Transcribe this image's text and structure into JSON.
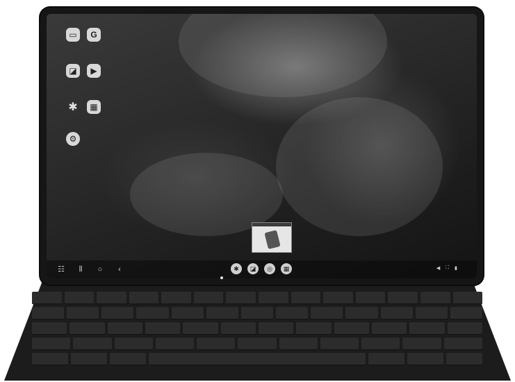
{
  "desktop": {
    "apps": [
      {
        "icon": "message-app-icon",
        "glyph": "▭",
        "label": ""
      },
      {
        "icon": "google-app-icon",
        "glyph": "G",
        "label": ""
      },
      {
        "icon": "gallery-app-icon",
        "glyph": "◪",
        "label": ""
      },
      {
        "icon": "play-store-icon",
        "glyph": "▶",
        "label": ""
      },
      {
        "icon": "bixby-app-icon",
        "glyph": "✱",
        "label": ""
      },
      {
        "icon": "apps-grid-icon",
        "glyph": "▦",
        "label": ""
      },
      {
        "icon": "settings-app-icon",
        "glyph": "⚙",
        "label": ""
      }
    ]
  },
  "recent_preview": {
    "caption": ""
  },
  "taskbar": {
    "nav": {
      "apps_glyph": "☷",
      "recents_glyph": "⦀",
      "home_glyph": "○",
      "back_glyph": "‹"
    },
    "dock": [
      {
        "icon": "bixby-dock-icon",
        "glyph": "✱"
      },
      {
        "icon": "gallery-dock-icon",
        "glyph": "◪"
      },
      {
        "icon": "samsung-internet-icon",
        "glyph": "◎"
      },
      {
        "icon": "apps-dock-icon",
        "glyph": "▦"
      }
    ],
    "status": {
      "volume_glyph": "◀",
      "screenshot_glyph": "⛶",
      "battery_glyph": "▮",
      "network_text": "",
      "time_text": ""
    }
  }
}
